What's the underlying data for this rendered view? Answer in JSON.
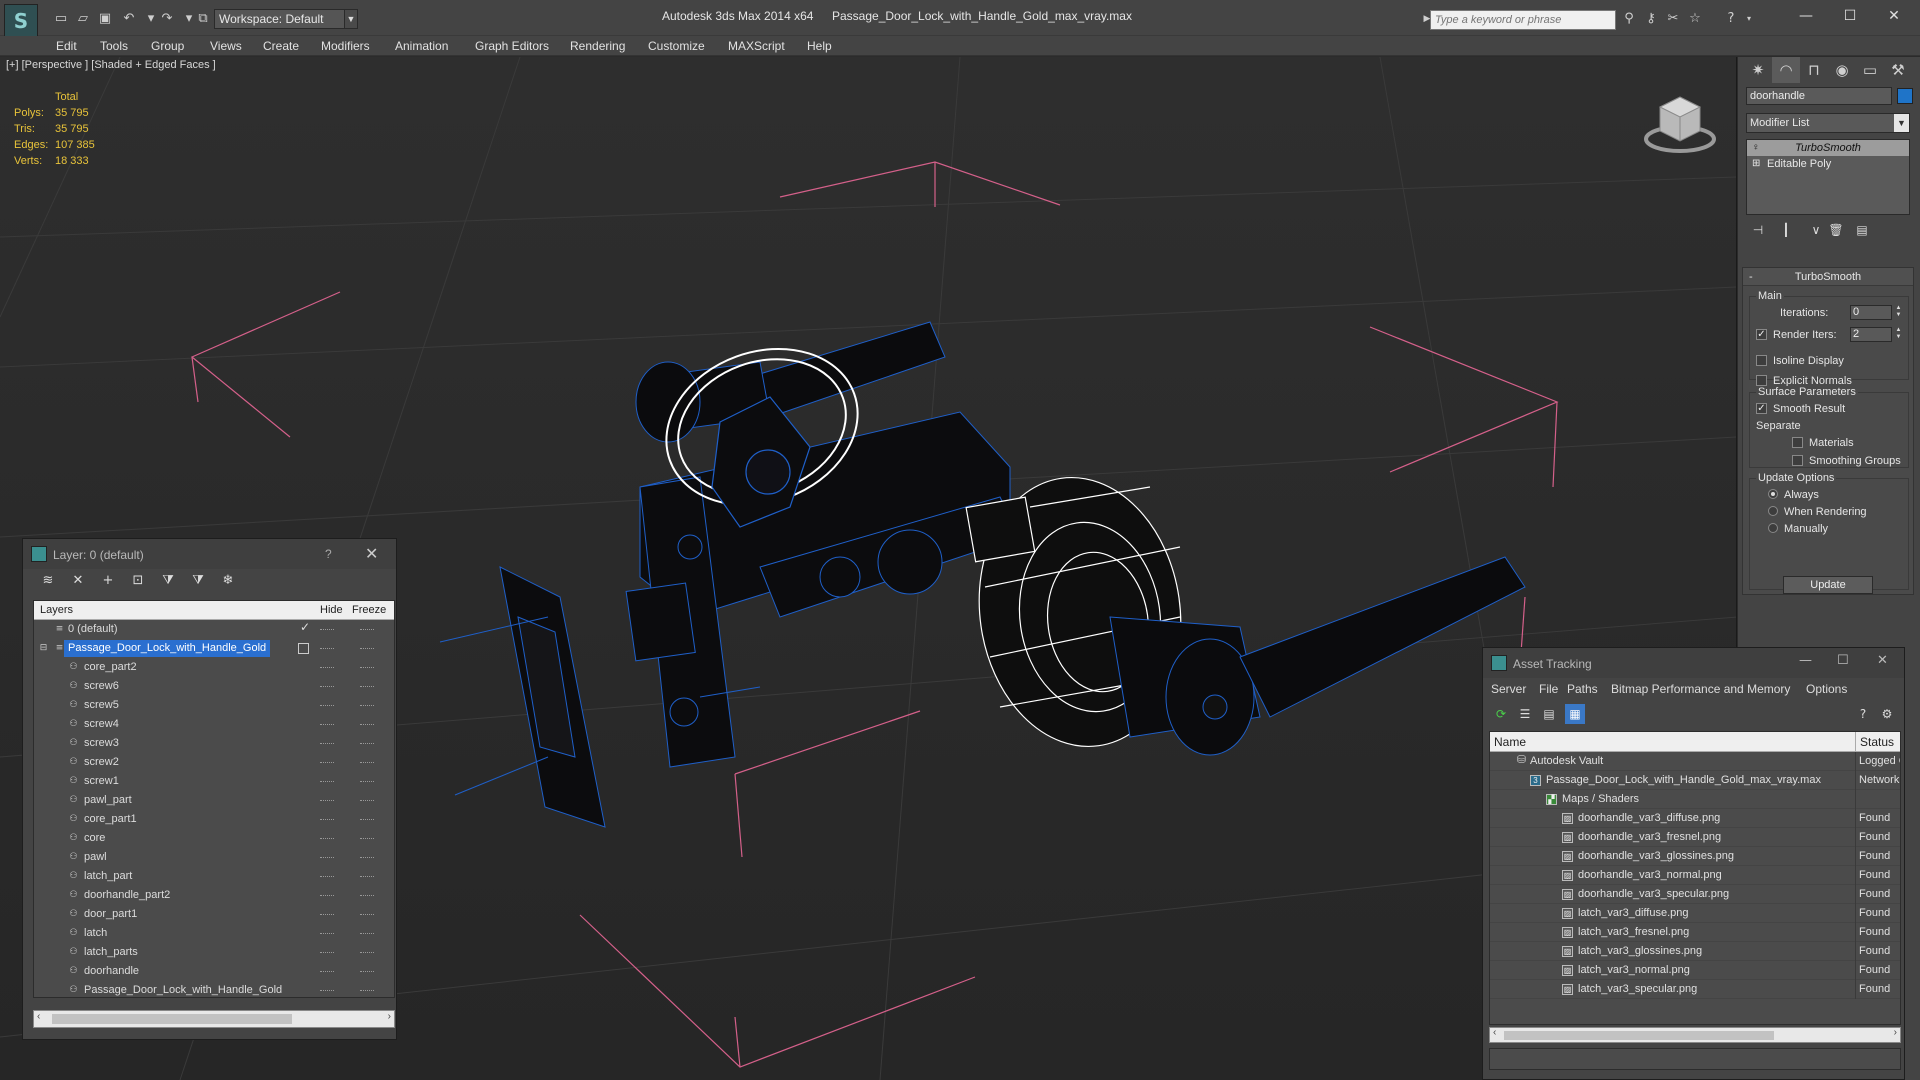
{
  "titlebar": {
    "app_title": "Autodesk 3ds Max  2014 x64",
    "file_title": "Passage_Door_Lock_with_Handle_Gold_max_vray.max",
    "workspace": "Workspace: Default",
    "search_placeholder": "Type a keyword or phrase",
    "logo_icon": "3ds-max-logo-icon",
    "quick_access_icons": [
      "new-file-icon",
      "open-file-icon",
      "save-icon",
      "undo-icon",
      "redo-icon",
      "project-folder-icon"
    ],
    "window_controls": [
      "minimize-icon",
      "maximize-icon",
      "close-icon"
    ]
  },
  "menu": {
    "items": [
      "Edit",
      "Tools",
      "Group",
      "Views",
      "Create",
      "Modifiers",
      "Animation",
      "Graph Editors",
      "Rendering",
      "Customize",
      "MAXScript",
      "Help"
    ]
  },
  "viewport": {
    "label": "[+] [Perspective ] [Shaded + Edged Faces ]",
    "stats": {
      "header": "Total",
      "polys_label": "Polys:",
      "polys": "35 795",
      "tris_label": "Tris:",
      "tris": "35 795",
      "edges_label": "Edges:",
      "edges": "107 385",
      "verts_label": "Verts:",
      "verts": "18 333"
    },
    "colors": {
      "stats": "#e8c33a",
      "bounding_box": "#d4608a",
      "wire": "#1f5fc8",
      "selected_wire": "#ffffff"
    }
  },
  "command_panel": {
    "tabs": [
      "create-icon",
      "modify-icon",
      "hierarchy-icon",
      "motion-icon",
      "display-icon",
      "utilities-icon"
    ],
    "object_name": "doorhandle",
    "object_color": "#1f74c8",
    "modifier_list": "Modifier List",
    "stack": [
      "TurboSmooth",
      "Editable Poly"
    ],
    "rollout": {
      "title": "TurboSmooth",
      "main_label": "Main",
      "iterations_label": "Iterations:",
      "iterations": "0",
      "render_iters_label": "Render Iters:",
      "render_iters": "2",
      "isoline_label": "Isoline Display",
      "explicit_label": "Explicit Normals",
      "surface_label": "Surface Parameters",
      "smooth_label": "Smooth Result",
      "separate_label": "Separate",
      "materials_label": "Materials",
      "smoothing_label": "Smoothing Groups",
      "update_label": "Update Options",
      "always_label": "Always",
      "when_rendering_label": "When Rendering",
      "manually_label": "Manually",
      "update_button": "Update"
    }
  },
  "layer_window": {
    "title": "Layer: 0 (default)",
    "help": "?",
    "columns": {
      "layers": "Layers",
      "hide": "Hide",
      "freeze": "Freeze"
    },
    "default_layer": "0 (default)",
    "selected_layer": "Passage_Door_Lock_with_Handle_Gold",
    "objects": [
      "core_part2",
      "screw6",
      "screw5",
      "screw4",
      "screw3",
      "screw2",
      "screw1",
      "pawl_part",
      "core_part1",
      "core",
      "pawl",
      "latch_part",
      "doorhandle_part2",
      "door_part1",
      "latch",
      "latch_parts",
      "doorhandle",
      "Passage_Door_Lock_with_Handle_Gold"
    ]
  },
  "asset_window": {
    "title": "Asset Tracking",
    "menu": [
      "Server",
      "File",
      "Paths",
      "Bitmap Performance and Memory",
      "Options"
    ],
    "columns": {
      "name": "Name",
      "status": "Status"
    },
    "rows": [
      {
        "name": "Autodesk Vault",
        "status": "Logged C",
        "indent": 1
      },
      {
        "name": "Passage_Door_Lock_with_Handle_Gold_max_vray.max",
        "status": "Network",
        "indent": 2
      },
      {
        "name": "Maps / Shaders",
        "status": "",
        "indent": 3
      },
      {
        "name": "doorhandle_var3_diffuse.png",
        "status": "Found",
        "indent": 4
      },
      {
        "name": "doorhandle_var3_fresnel.png",
        "status": "Found",
        "indent": 4
      },
      {
        "name": "doorhandle_var3_glossines.png",
        "status": "Found",
        "indent": 4
      },
      {
        "name": "doorhandle_var3_normal.png",
        "status": "Found",
        "indent": 4
      },
      {
        "name": "doorhandle_var3_specular.png",
        "status": "Found",
        "indent": 4
      },
      {
        "name": "latch_var3_diffuse.png",
        "status": "Found",
        "indent": 4
      },
      {
        "name": "latch_var3_fresnel.png",
        "status": "Found",
        "indent": 4
      },
      {
        "name": "latch_var3_glossines.png",
        "status": "Found",
        "indent": 4
      },
      {
        "name": "latch_var3_normal.png",
        "status": "Found",
        "indent": 4
      },
      {
        "name": "latch_var3_specular.png",
        "status": "Found",
        "indent": 4
      }
    ]
  }
}
